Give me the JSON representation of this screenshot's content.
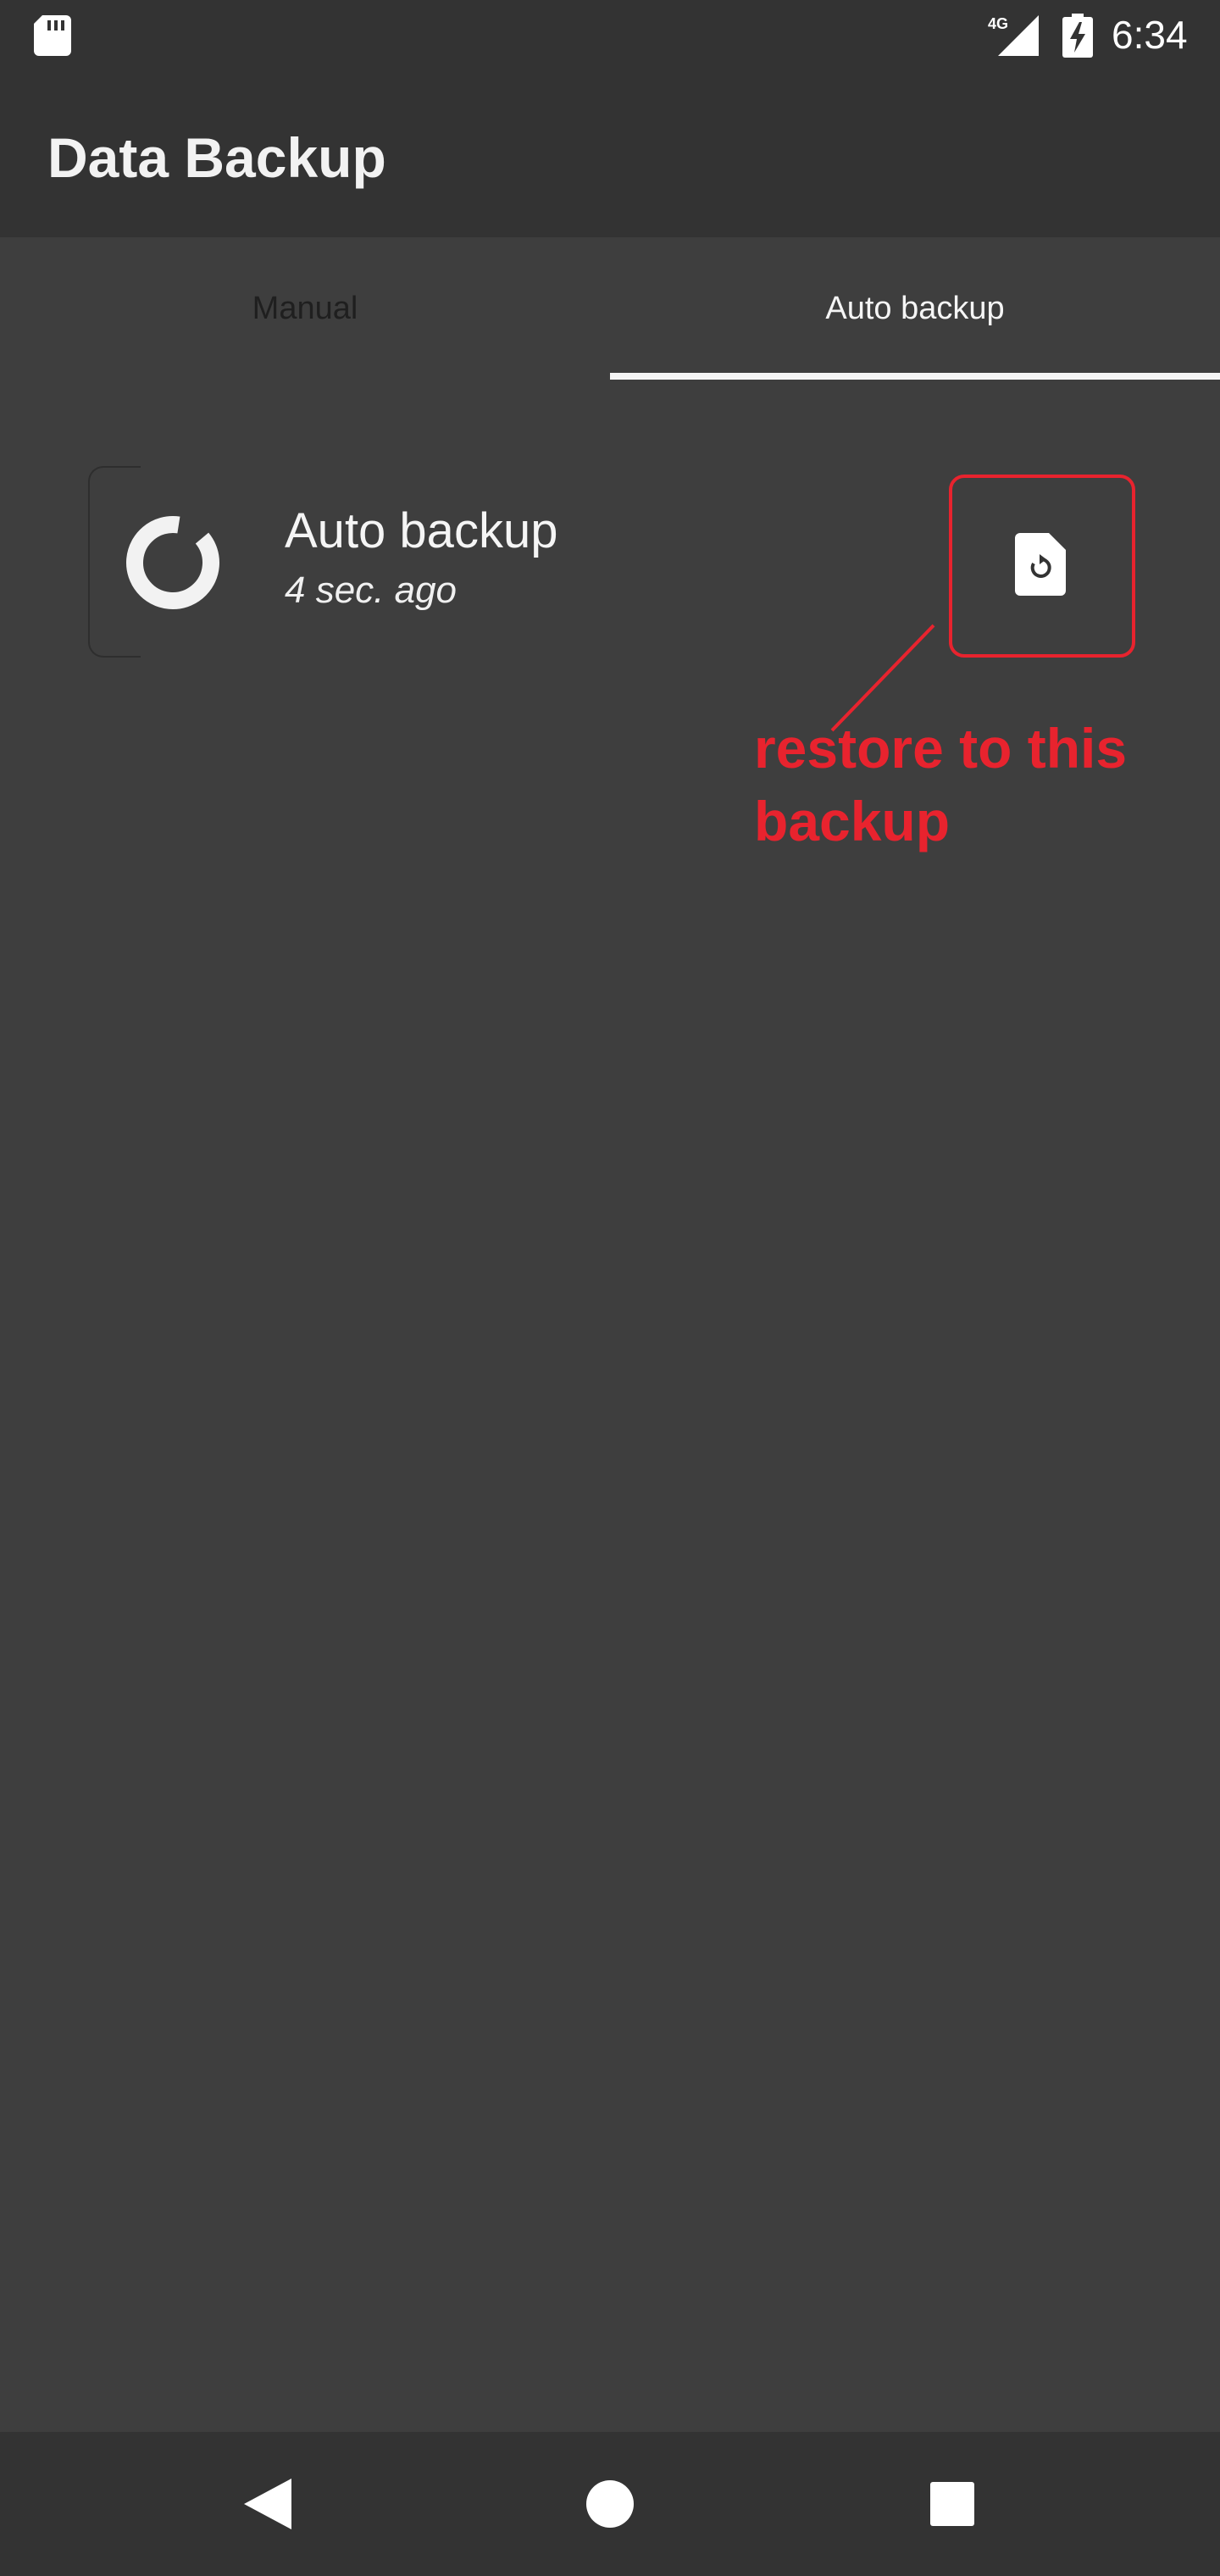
{
  "status_bar": {
    "time": "6:34",
    "network": "4G",
    "icons": [
      "sd-card-icon",
      "signal-icon",
      "battery-charging-icon"
    ]
  },
  "app_bar": {
    "title": "Data Backup"
  },
  "tabs": [
    {
      "label": "Manual",
      "selected": false
    },
    {
      "label": "Auto backup",
      "selected": true
    }
  ],
  "backup_list": [
    {
      "title": "Auto backup",
      "subtitle": "4 sec. ago",
      "status_icon": "progress-ring-icon",
      "action_icon": "file-restore-icon"
    }
  ],
  "annotation": {
    "text": "restore to this backup",
    "color": "#e8232e"
  },
  "nav_bar": {
    "icons": [
      "back-icon",
      "home-icon",
      "recents-icon"
    ]
  },
  "colors": {
    "background": "#3e3e3e",
    "bars": "#333333",
    "text": "#f5f5f5",
    "tab_inactive": "#1f1f1f"
  }
}
